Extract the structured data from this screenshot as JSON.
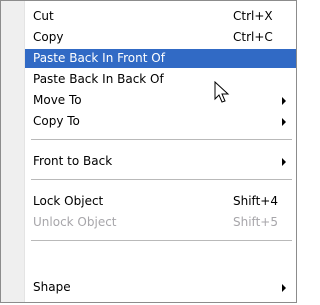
{
  "menu": {
    "items": [
      {
        "label": "Cut",
        "shortcut": "Ctrl+X"
      },
      {
        "label": "Copy",
        "shortcut": "Ctrl+C"
      },
      {
        "label": "Paste Back In Front Of",
        "shortcut": ""
      },
      {
        "label": "Paste Back In Back Of",
        "shortcut": ""
      },
      {
        "label": "Move To",
        "shortcut": ""
      },
      {
        "label": "Copy To",
        "shortcut": ""
      },
      {
        "label": "Front to Back",
        "shortcut": ""
      },
      {
        "label": "Lock Object",
        "shortcut": "Shift+4"
      },
      {
        "label": "Unlock Object",
        "shortcut": "Shift+5"
      },
      {
        "label": "Shape",
        "shortcut": ""
      }
    ]
  },
  "colors": {
    "highlight": "#316ac5",
    "disabled_text": "#a7a6aa",
    "sidebar": "#efefef"
  },
  "icons": {
    "submenu": "submenu-arrow-icon",
    "cursor": "mouse-pointer-icon"
  }
}
